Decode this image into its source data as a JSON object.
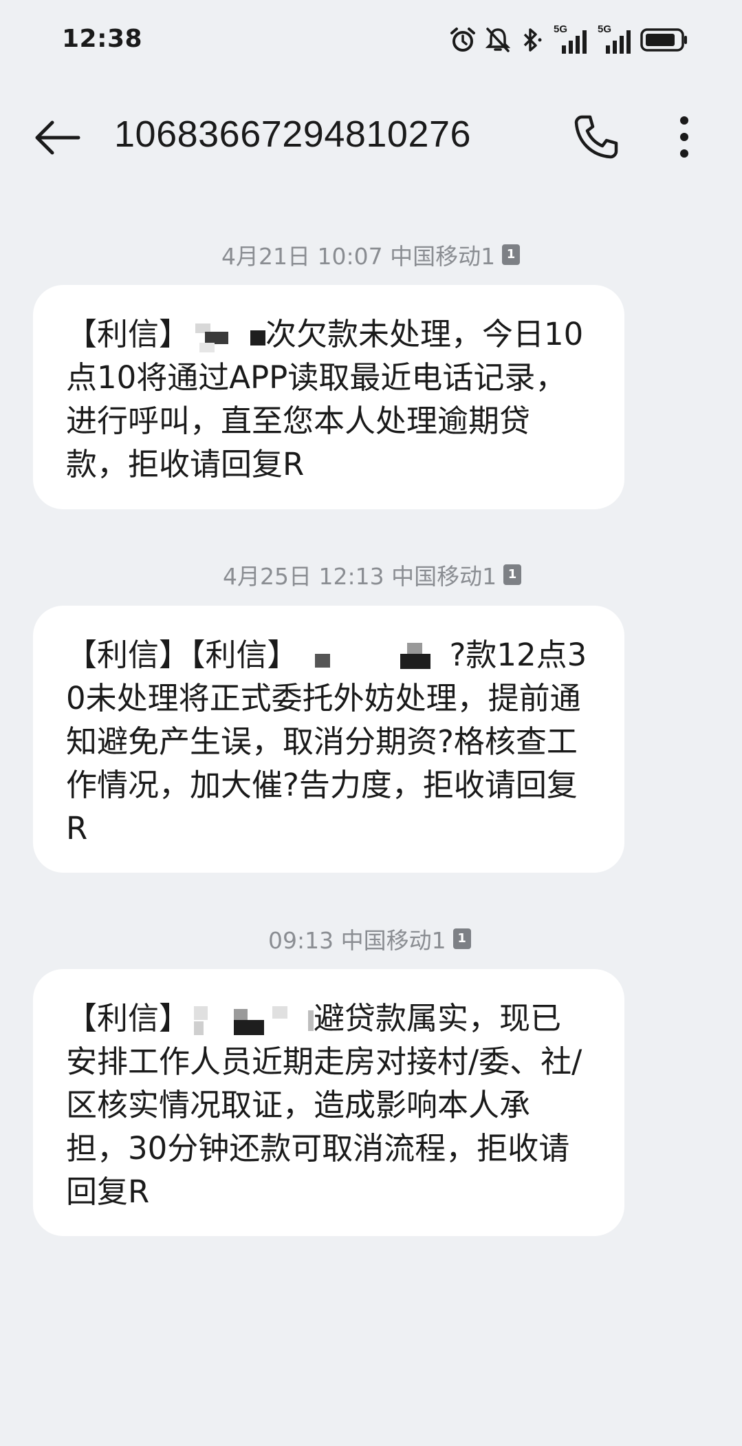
{
  "status_bar": {
    "time": "12:38",
    "network_1": "5G",
    "network_2": "5G",
    "icons": [
      "alarm-icon",
      "mute-icon",
      "bluetooth-icon",
      "signal-icon",
      "signal-icon",
      "battery-icon"
    ]
  },
  "header": {
    "title": "10683667294810276",
    "back_icon": "back-arrow-icon",
    "call_icon": "phone-icon",
    "more_icon": "more-vertical-icon"
  },
  "messages": [
    {
      "meta": "4月21日 10:07  中国移动1",
      "sim": "1",
      "text_a": "【利信】",
      "text_b": "次欠款未处理，今日10点10将通过APP读取最近电话记录，进行呼叫，直至您本人处理逾期贷款，拒收请回复R"
    },
    {
      "meta": "4月25日 12:13  中国移动1",
      "sim": "1",
      "text_a": "【利信】【利信】",
      "text_b": "?款12点30未处理将正式委托外妨处理，提前通知避免产生误，取消分期资?格核查工作情况，加大催?告力度，拒收请回复R"
    },
    {
      "meta": "09:13  中国移动1",
      "sim": "1",
      "text_a": "【利信】",
      "text_b": "避贷款属实，现已安排工作人员近期走房对接村/委、社/区核实情况取证，造成影响本人承担，30分钟还款可取消流程，拒收请回复R"
    }
  ]
}
